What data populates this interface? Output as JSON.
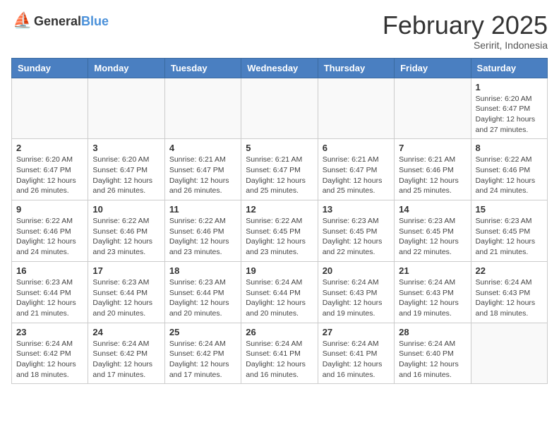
{
  "header": {
    "logo_general": "General",
    "logo_blue": "Blue",
    "month_year": "February 2025",
    "location": "Seririt, Indonesia"
  },
  "weekdays": [
    "Sunday",
    "Monday",
    "Tuesday",
    "Wednesday",
    "Thursday",
    "Friday",
    "Saturday"
  ],
  "weeks": [
    [
      {
        "day": "",
        "info": ""
      },
      {
        "day": "",
        "info": ""
      },
      {
        "day": "",
        "info": ""
      },
      {
        "day": "",
        "info": ""
      },
      {
        "day": "",
        "info": ""
      },
      {
        "day": "",
        "info": ""
      },
      {
        "day": "1",
        "info": "Sunrise: 6:20 AM\nSunset: 6:47 PM\nDaylight: 12 hours\nand 27 minutes."
      }
    ],
    [
      {
        "day": "2",
        "info": "Sunrise: 6:20 AM\nSunset: 6:47 PM\nDaylight: 12 hours\nand 26 minutes."
      },
      {
        "day": "3",
        "info": "Sunrise: 6:20 AM\nSunset: 6:47 PM\nDaylight: 12 hours\nand 26 minutes."
      },
      {
        "day": "4",
        "info": "Sunrise: 6:21 AM\nSunset: 6:47 PM\nDaylight: 12 hours\nand 26 minutes."
      },
      {
        "day": "5",
        "info": "Sunrise: 6:21 AM\nSunset: 6:47 PM\nDaylight: 12 hours\nand 25 minutes."
      },
      {
        "day": "6",
        "info": "Sunrise: 6:21 AM\nSunset: 6:47 PM\nDaylight: 12 hours\nand 25 minutes."
      },
      {
        "day": "7",
        "info": "Sunrise: 6:21 AM\nSunset: 6:46 PM\nDaylight: 12 hours\nand 25 minutes."
      },
      {
        "day": "8",
        "info": "Sunrise: 6:22 AM\nSunset: 6:46 PM\nDaylight: 12 hours\nand 24 minutes."
      }
    ],
    [
      {
        "day": "9",
        "info": "Sunrise: 6:22 AM\nSunset: 6:46 PM\nDaylight: 12 hours\nand 24 minutes."
      },
      {
        "day": "10",
        "info": "Sunrise: 6:22 AM\nSunset: 6:46 PM\nDaylight: 12 hours\nand 23 minutes."
      },
      {
        "day": "11",
        "info": "Sunrise: 6:22 AM\nSunset: 6:46 PM\nDaylight: 12 hours\nand 23 minutes."
      },
      {
        "day": "12",
        "info": "Sunrise: 6:22 AM\nSunset: 6:45 PM\nDaylight: 12 hours\nand 23 minutes."
      },
      {
        "day": "13",
        "info": "Sunrise: 6:23 AM\nSunset: 6:45 PM\nDaylight: 12 hours\nand 22 minutes."
      },
      {
        "day": "14",
        "info": "Sunrise: 6:23 AM\nSunset: 6:45 PM\nDaylight: 12 hours\nand 22 minutes."
      },
      {
        "day": "15",
        "info": "Sunrise: 6:23 AM\nSunset: 6:45 PM\nDaylight: 12 hours\nand 21 minutes."
      }
    ],
    [
      {
        "day": "16",
        "info": "Sunrise: 6:23 AM\nSunset: 6:44 PM\nDaylight: 12 hours\nand 21 minutes."
      },
      {
        "day": "17",
        "info": "Sunrise: 6:23 AM\nSunset: 6:44 PM\nDaylight: 12 hours\nand 20 minutes."
      },
      {
        "day": "18",
        "info": "Sunrise: 6:23 AM\nSunset: 6:44 PM\nDaylight: 12 hours\nand 20 minutes."
      },
      {
        "day": "19",
        "info": "Sunrise: 6:24 AM\nSunset: 6:44 PM\nDaylight: 12 hours\nand 20 minutes."
      },
      {
        "day": "20",
        "info": "Sunrise: 6:24 AM\nSunset: 6:43 PM\nDaylight: 12 hours\nand 19 minutes."
      },
      {
        "day": "21",
        "info": "Sunrise: 6:24 AM\nSunset: 6:43 PM\nDaylight: 12 hours\nand 19 minutes."
      },
      {
        "day": "22",
        "info": "Sunrise: 6:24 AM\nSunset: 6:43 PM\nDaylight: 12 hours\nand 18 minutes."
      }
    ],
    [
      {
        "day": "23",
        "info": "Sunrise: 6:24 AM\nSunset: 6:42 PM\nDaylight: 12 hours\nand 18 minutes."
      },
      {
        "day": "24",
        "info": "Sunrise: 6:24 AM\nSunset: 6:42 PM\nDaylight: 12 hours\nand 17 minutes."
      },
      {
        "day": "25",
        "info": "Sunrise: 6:24 AM\nSunset: 6:42 PM\nDaylight: 12 hours\nand 17 minutes."
      },
      {
        "day": "26",
        "info": "Sunrise: 6:24 AM\nSunset: 6:41 PM\nDaylight: 12 hours\nand 16 minutes."
      },
      {
        "day": "27",
        "info": "Sunrise: 6:24 AM\nSunset: 6:41 PM\nDaylight: 12 hours\nand 16 minutes."
      },
      {
        "day": "28",
        "info": "Sunrise: 6:24 AM\nSunset: 6:40 PM\nDaylight: 12 hours\nand 16 minutes."
      },
      {
        "day": "",
        "info": ""
      }
    ]
  ]
}
